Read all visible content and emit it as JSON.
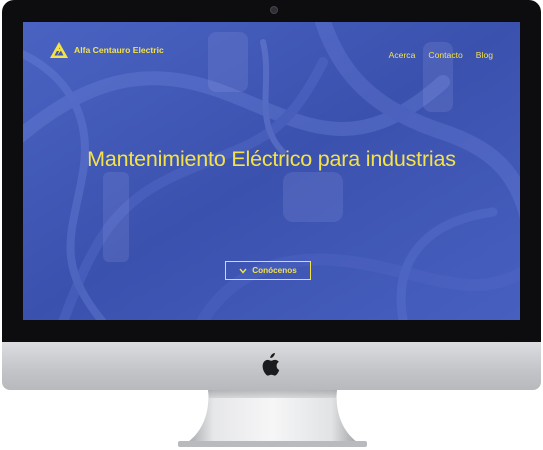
{
  "brand": {
    "name": "Alfa Centauro Electric",
    "logo_icon": "alfa-centauro-logo-icon"
  },
  "nav": {
    "links": [
      {
        "label": "Acerca"
      },
      {
        "label": "Contacto"
      },
      {
        "label": "Blog"
      }
    ]
  },
  "hero": {
    "title": "Mantenimiento Eléctrico para industrias",
    "cta_label": "Conócenos",
    "cta_icon": "chevron-down-icon"
  },
  "device": {
    "type": "imac",
    "logo": "apple-icon"
  },
  "colors": {
    "accent": "#f3e24a",
    "screen_bg": "#3f56b4",
    "bezel": "#0d0d0f",
    "chin": "#c6c7cb"
  }
}
